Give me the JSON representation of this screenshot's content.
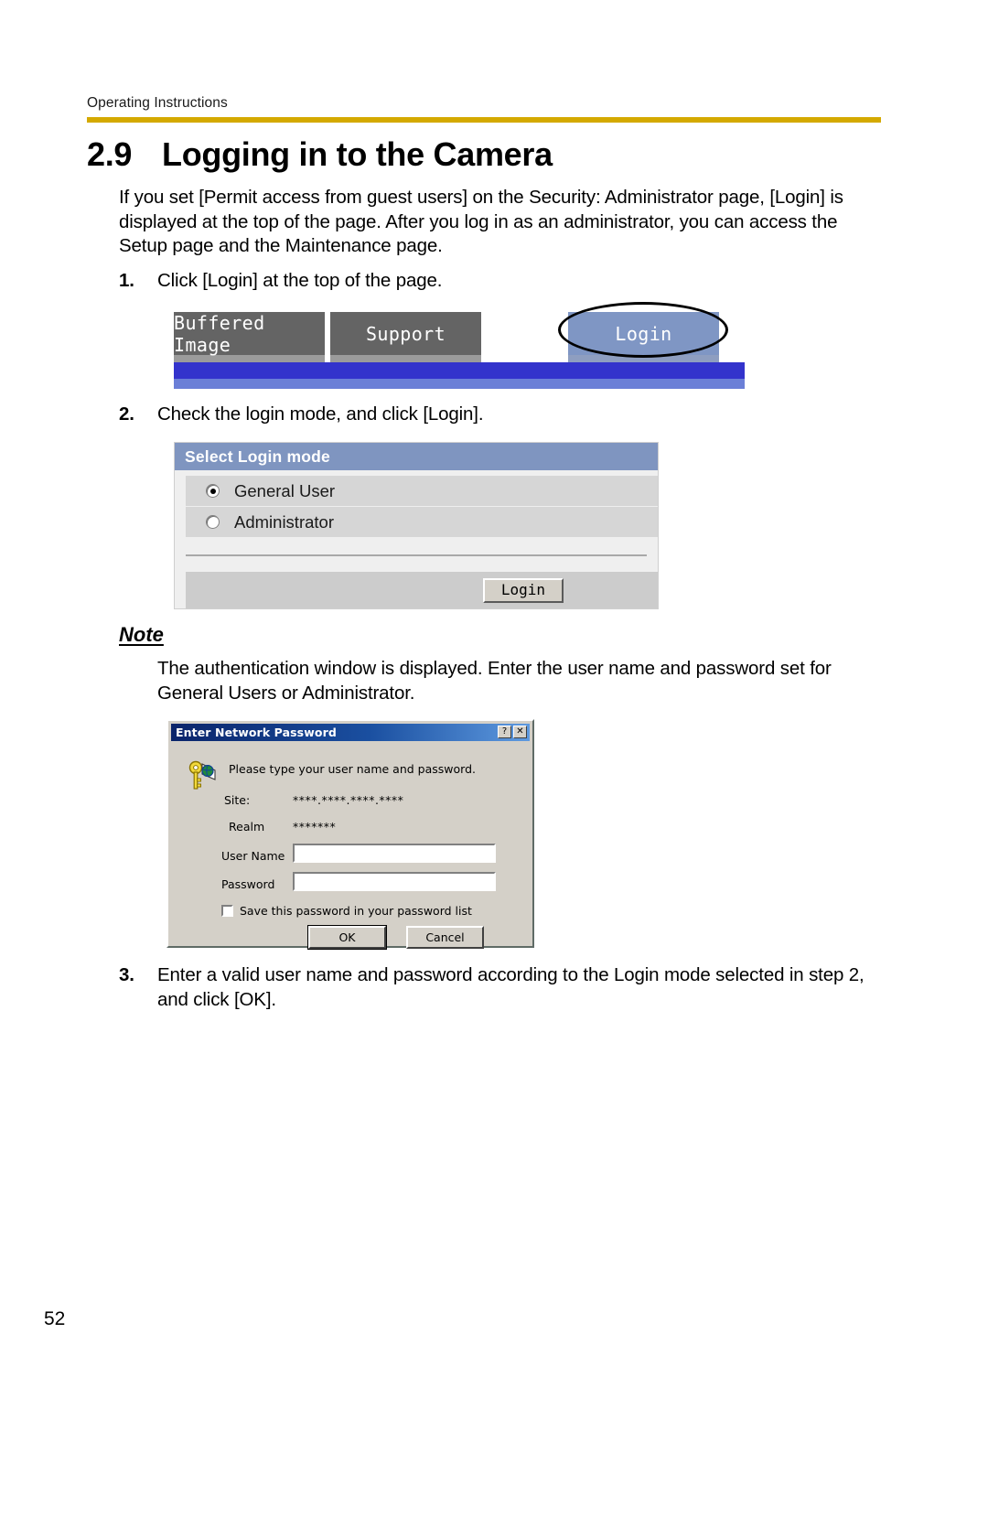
{
  "header": {
    "running_title": "Operating Instructions",
    "rule_color": "#d4a900"
  },
  "section": {
    "number": "2.9",
    "title": "Logging in to the Camera"
  },
  "intro": "If you set [Permit access from guest users] on the Security: Administrator page, [Login] is displayed at the top of the page. After you log in as an administrator, you can access the Setup page and the Maintenance page.",
  "steps": [
    {
      "number": "1.",
      "text": "Click [Login] at the top of the page."
    },
    {
      "number": "2.",
      "text": "Check the login mode, and click [Login]."
    },
    {
      "number": "3.",
      "text": "Enter a valid user name and password according to the Login mode selected in step 2, and click [OK]."
    }
  ],
  "note": {
    "heading": "Note",
    "text": "The authentication window is displayed. Enter the user name and password set for General Users or Administrator."
  },
  "figure_nav": {
    "tabs": [
      {
        "label": "Buffered Image"
      },
      {
        "label": "Support"
      }
    ],
    "login_tab": "Login",
    "tab_bg": "#646464",
    "login_tab_bg": "#7f96c4",
    "bar_color": "#3333cc"
  },
  "figure_login_mode": {
    "panel_title": "Select Login mode",
    "panel_title_bg": "#7f95c0",
    "options": [
      {
        "label": "General User",
        "selected": true
      },
      {
        "label": "Administrator",
        "selected": false
      }
    ],
    "submit_label": "Login"
  },
  "figure_dialog": {
    "title": "Enter Network Password",
    "title_help_glyph": "?",
    "title_close_glyph": "✕",
    "prompt": "Please type your user name and password.",
    "rows": [
      {
        "label": "Site:",
        "value": "****.****.****.****"
      },
      {
        "label": "Realm",
        "value": "*******"
      }
    ],
    "user_name_label": "User Name",
    "user_name_value": "",
    "password_label": "Password",
    "password_value": "",
    "save_password_label": "Save this password in your password list",
    "save_password_checked": false,
    "ok_label": "OK",
    "cancel_label": "Cancel"
  },
  "page_number": "52"
}
